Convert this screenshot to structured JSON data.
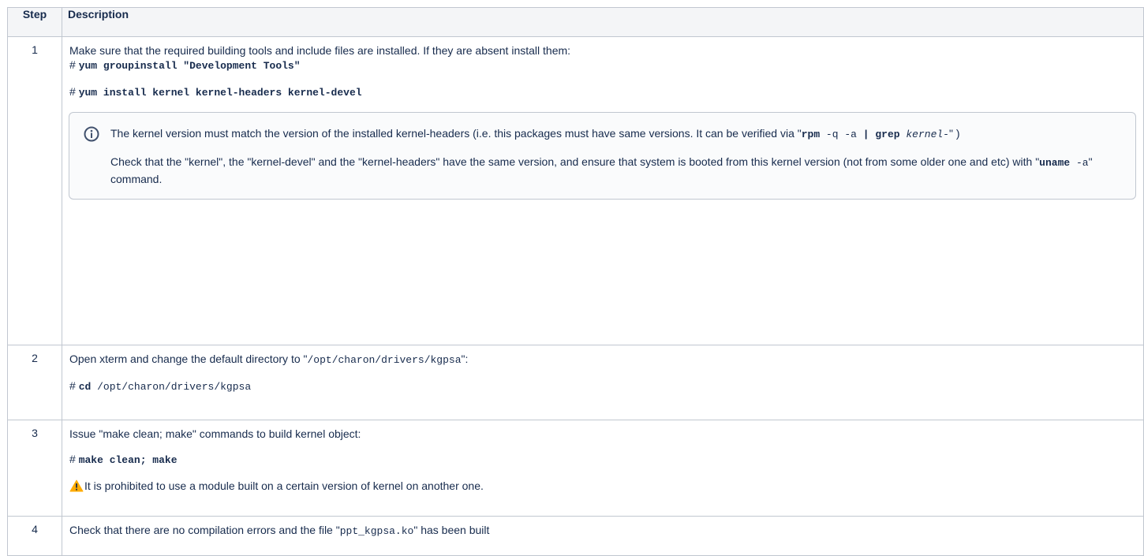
{
  "table": {
    "headers": {
      "step": "Step",
      "description": "Description"
    },
    "rows": [
      {
        "num": "1",
        "intro": "Make sure that the required building tools and include files are installed. If they are absent install them:",
        "cmd1": {
          "prompt": "#",
          "command": "yum groupinstall \"Development Tools\""
        },
        "cmd2": {
          "prompt": "#",
          "command": "yum install kernel kernel-headers kernel-devel"
        },
        "info": {
          "icon": "info-icon",
          "p1_prefix": "The kernel version must match the version of the installed kernel-headers (i.e. this packages must have same versions. It can be verified via \"",
          "p1_rpm": "rpm",
          "p1_rpm_args": " -q -a ",
          "p1_pipe": "|",
          "p1_grep": " grep",
          "p1_kernel": " kernel-",
          "p1_suffix": "\" )",
          "p2_prefix": "Check that the \"kernel\", the \"kernel-devel\" and the \"kernel-headers\" have the same version, and ensure that system is booted from this kernel version (not from some older one and etc) with \"",
          "p2_uname": "uname",
          "p2_args": " -a",
          "p2_suffix": "\" command."
        }
      },
      {
        "num": "2",
        "intro_prefix": "Open xterm and change the default directory to \"",
        "intro_path": "/opt/charon/drivers/kgpsa",
        "intro_suffix": "\":",
        "cmd": {
          "prompt": "#",
          "command": "cd",
          "arg": " /opt/charon/drivers/kgpsa"
        }
      },
      {
        "num": "3",
        "intro": "Issue \"make clean; make\" commands to build kernel object:",
        "cmd": {
          "prompt": "#",
          "command": "make clean; make"
        },
        "warning": {
          "icon": "warning-icon",
          "text": "It is prohibited to use a module built on a certain version of kernel on another one."
        }
      },
      {
        "num": "4",
        "intro_prefix": "Check that there are no compilation errors and the file \"",
        "intro_file": "ppt_kgpsa.ko",
        "intro_suffix": "\" has been built"
      }
    ]
  }
}
